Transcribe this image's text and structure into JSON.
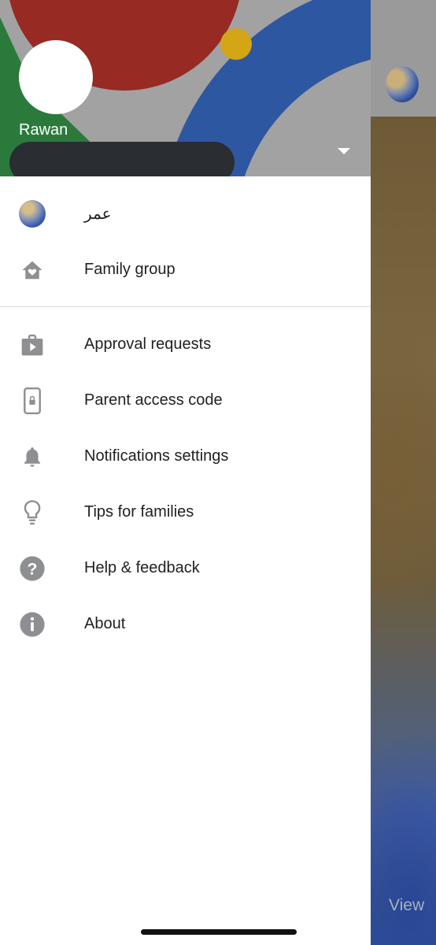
{
  "background": {
    "view_label": "View"
  },
  "header": {
    "profile_name": "Rawan"
  },
  "menu": {
    "section1": [
      {
        "label": "عمر",
        "icon": "child-avatar"
      },
      {
        "label": "Family group",
        "icon": "home-heart-icon"
      }
    ],
    "section2": [
      {
        "label": "Approval requests",
        "icon": "play-store-bag-icon"
      },
      {
        "label": "Parent access code",
        "icon": "phone-lock-icon"
      },
      {
        "label": "Notifications settings",
        "icon": "bell-icon"
      },
      {
        "label": "Tips for families",
        "icon": "lightbulb-icon"
      },
      {
        "label": "Help & feedback",
        "icon": "help-icon"
      },
      {
        "label": "About",
        "icon": "info-icon"
      }
    ]
  },
  "colors": {
    "header_gray": "#a2a2a2",
    "red": "#972a22",
    "blue": "#2e57a2",
    "green": "#2b7a3c",
    "yellow": "#d4a514",
    "icon_gray": "#8e8f93",
    "text": "#202124"
  }
}
